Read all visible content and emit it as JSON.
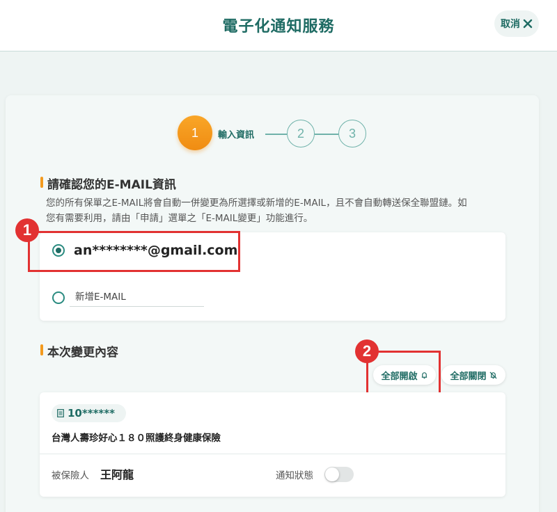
{
  "header": {
    "title": "電子化通知服務",
    "cancel_label": "取消"
  },
  "stepper": {
    "steps": [
      {
        "number": "1",
        "label": "輸入資訊",
        "active": true
      },
      {
        "number": "2",
        "label": "",
        "active": false
      },
      {
        "number": "3",
        "label": "",
        "active": false
      }
    ]
  },
  "email_section": {
    "title": "請確認您的E-MAIL資訊",
    "description_line1": "您的所有保單之E-MAIL將會自動一併變更為所選擇或新增的E-MAIL，且不會自動轉送保全聯盟鏈。如",
    "description_line2": "您有需要利用，請由「申請」選單之「E-MAIL變更」功能進行。",
    "options": [
      {
        "value": "an********@gmail.com",
        "checked": true
      },
      {
        "placeholder": "新增E-MAIL",
        "checked": false
      }
    ]
  },
  "change_section": {
    "title": "本次變更內容",
    "enable_all_label": "全部開啟",
    "disable_all_label": "全部關閉"
  },
  "policy": {
    "number": "10******",
    "name": "台灣人壽珍好心１８０照護終身健康保險",
    "insured_label": "被保險人",
    "insured_name": "王阿龍",
    "notify_label": "通知狀態",
    "notify_on": false
  },
  "annotations": {
    "badge1": "1",
    "badge2": "2"
  },
  "colors": {
    "primary": "#1e6b63",
    "accent_orange": "#f39a1e",
    "highlight_red": "#e23232",
    "background": "#eef4f3"
  }
}
